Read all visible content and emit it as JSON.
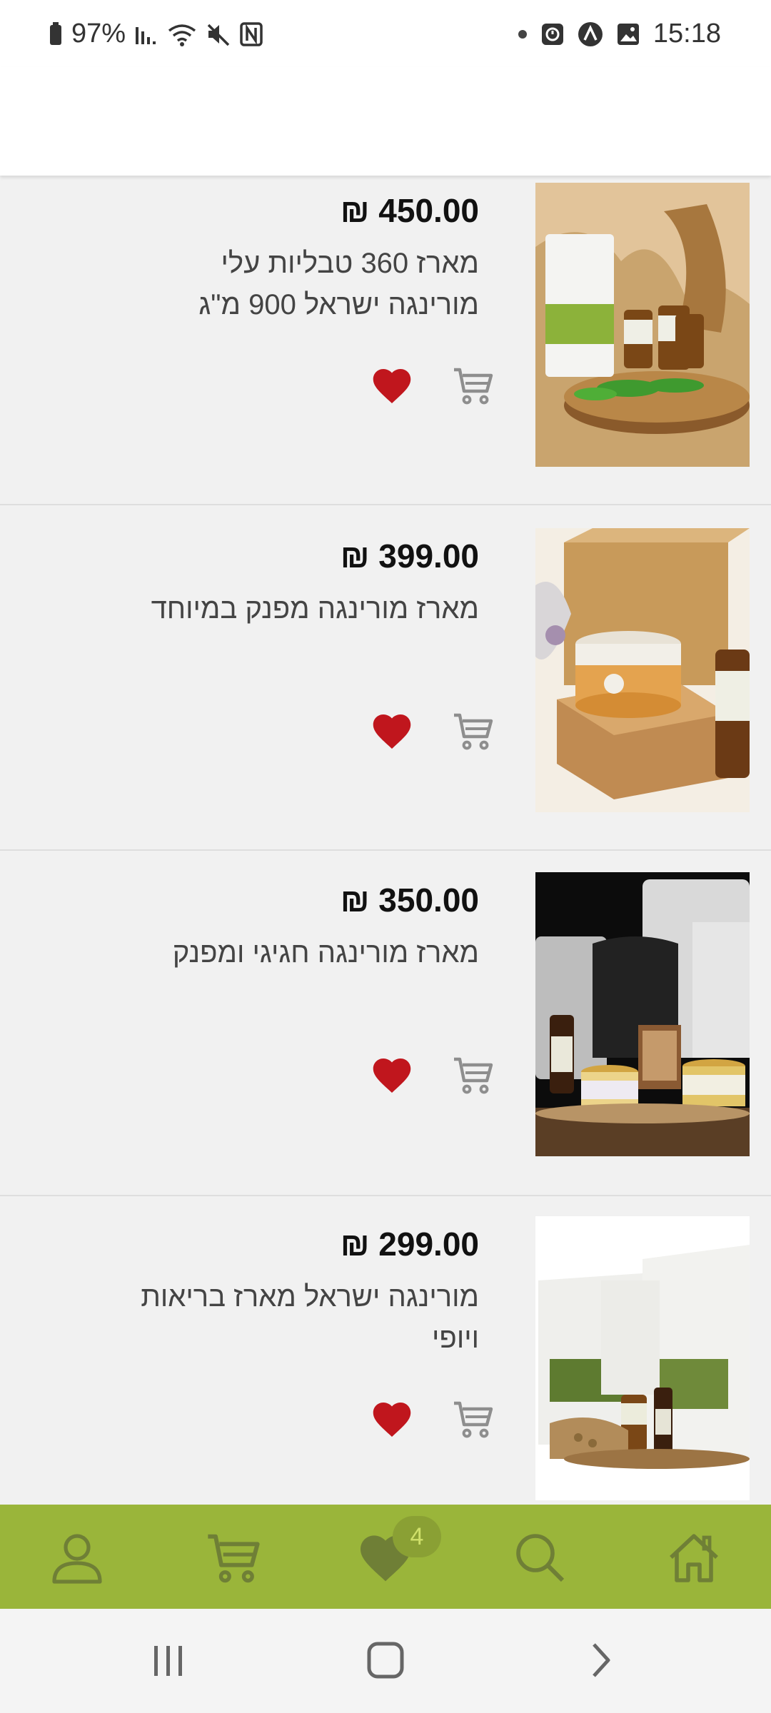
{
  "status_bar": {
    "battery_percent": "97%",
    "time": "15:18"
  },
  "products": [
    {
      "price": "₪ 450.00",
      "title": "מארז 360 טבליות עלי מורינגה ישראל 900 מ\"ג"
    },
    {
      "price": "₪ 399.00",
      "title": "מארז מורינגה מפנק במיוחד"
    },
    {
      "price": "₪ 350.00",
      "title": "מארז מורינגה חגיגי ומפנק"
    },
    {
      "price": "₪ 299.00",
      "title": "מורינגה ישראל מארז בריאות ויופי"
    }
  ],
  "bottom_nav": {
    "wishlist_badge": "4",
    "icons": [
      "user-icon",
      "cart-icon",
      "heart-icon",
      "search-icon",
      "home-icon"
    ]
  },
  "colors": {
    "accent": "#9ab53a",
    "heart": "#c0161d",
    "icon_gray": "#8e8e8e"
  }
}
